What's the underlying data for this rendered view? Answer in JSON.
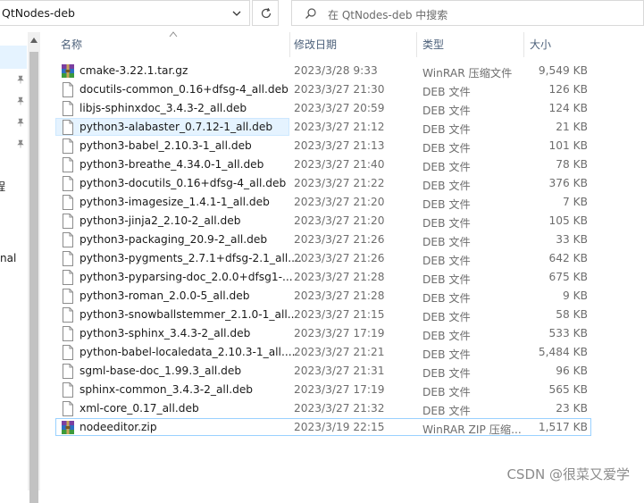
{
  "address": {
    "path": "QtNodes-deb"
  },
  "search": {
    "placeholder": "在 QtNodes-deb 中搜索"
  },
  "nav": {
    "labels": [
      "程",
      "nal"
    ]
  },
  "columns": {
    "name": "名称",
    "date": "修改日期",
    "type": "类型",
    "size": "大小"
  },
  "files": [
    {
      "name": "cmake-3.22.1.tar.gz",
      "date": "2023/3/28 9:33",
      "type": "WinRAR 压缩文件",
      "size": "9,549 KB",
      "icon": "winrar-archive-icon"
    },
    {
      "name": "docutils-common_0.16+dfsg-4_all.deb",
      "date": "2023/3/27 21:30",
      "type": "DEB 文件",
      "size": "126 KB",
      "icon": "file-icon"
    },
    {
      "name": "libjs-sphinxdoc_3.4.3-2_all.deb",
      "date": "2023/3/27 20:59",
      "type": "DEB 文件",
      "size": "124 KB",
      "icon": "file-icon"
    },
    {
      "name": "python3-alabaster_0.7.12-1_all.deb",
      "date": "2023/3/27 21:12",
      "type": "DEB 文件",
      "size": "21 KB",
      "icon": "file-icon"
    },
    {
      "name": "python3-babel_2.10.3-1_all.deb",
      "date": "2023/3/27 21:13",
      "type": "DEB 文件",
      "size": "101 KB",
      "icon": "file-icon"
    },
    {
      "name": "python3-breathe_4.34.0-1_all.deb",
      "date": "2023/3/27 21:40",
      "type": "DEB 文件",
      "size": "78 KB",
      "icon": "file-icon"
    },
    {
      "name": "python3-docutils_0.16+dfsg-4_all.deb",
      "date": "2023/3/27 21:22",
      "type": "DEB 文件",
      "size": "376 KB",
      "icon": "file-icon"
    },
    {
      "name": "python3-imagesize_1.4.1-1_all.deb",
      "date": "2023/3/27 21:20",
      "type": "DEB 文件",
      "size": "7 KB",
      "icon": "file-icon"
    },
    {
      "name": "python3-jinja2_2.10-2_all.deb",
      "date": "2023/3/27 21:20",
      "type": "DEB 文件",
      "size": "105 KB",
      "icon": "file-icon"
    },
    {
      "name": "python3-packaging_20.9-2_all.deb",
      "date": "2023/3/27 21:26",
      "type": "DEB 文件",
      "size": "33 KB",
      "icon": "file-icon"
    },
    {
      "name": "python3-pygments_2.7.1+dfsg-2.1_all....",
      "date": "2023/3/27 21:26",
      "type": "DEB 文件",
      "size": "642 KB",
      "icon": "file-icon"
    },
    {
      "name": "python3-pyparsing-doc_2.0.0+dfsg1-...",
      "date": "2023/3/27 21:28",
      "type": "DEB 文件",
      "size": "675 KB",
      "icon": "file-icon"
    },
    {
      "name": "python3-roman_2.0.0-5_all.deb",
      "date": "2023/3/27 21:28",
      "type": "DEB 文件",
      "size": "9 KB",
      "icon": "file-icon"
    },
    {
      "name": "python3-snowballstemmer_2.1.0-1_all...",
      "date": "2023/3/27 21:15",
      "type": "DEB 文件",
      "size": "58 KB",
      "icon": "file-icon"
    },
    {
      "name": "python3-sphinx_3.4.3-2_all.deb",
      "date": "2023/3/27 17:19",
      "type": "DEB 文件",
      "size": "533 KB",
      "icon": "file-icon"
    },
    {
      "name": "python-babel-localedata_2.10.3-1_all....",
      "date": "2023/3/27 21:21",
      "type": "DEB 文件",
      "size": "5,484 KB",
      "icon": "file-icon"
    },
    {
      "name": "sgml-base-doc_1.99.3_all.deb",
      "date": "2023/3/27 21:31",
      "type": "DEB 文件",
      "size": "96 KB",
      "icon": "file-icon"
    },
    {
      "name": "sphinx-common_3.4.3-2_all.deb",
      "date": "2023/3/27 17:19",
      "type": "DEB 文件",
      "size": "565 KB",
      "icon": "file-icon"
    },
    {
      "name": "xml-core_0.17_all.deb",
      "date": "2023/3/27 21:32",
      "type": "DEB 文件",
      "size": "23 KB",
      "icon": "file-icon"
    },
    {
      "name": "nodeeditor.zip",
      "date": "2023/3/19 22:15",
      "type": "WinRAR ZIP 压缩...",
      "size": "1,517 KB",
      "icon": "winrar-archive-icon"
    }
  ],
  "selected_row": 3,
  "focused_row": 19,
  "watermark": "CSDN @很菜又爱学",
  "colors": {
    "selection": "#e5f3ff",
    "focus_border": "#99d1ff",
    "header_text": "#4c607a"
  }
}
